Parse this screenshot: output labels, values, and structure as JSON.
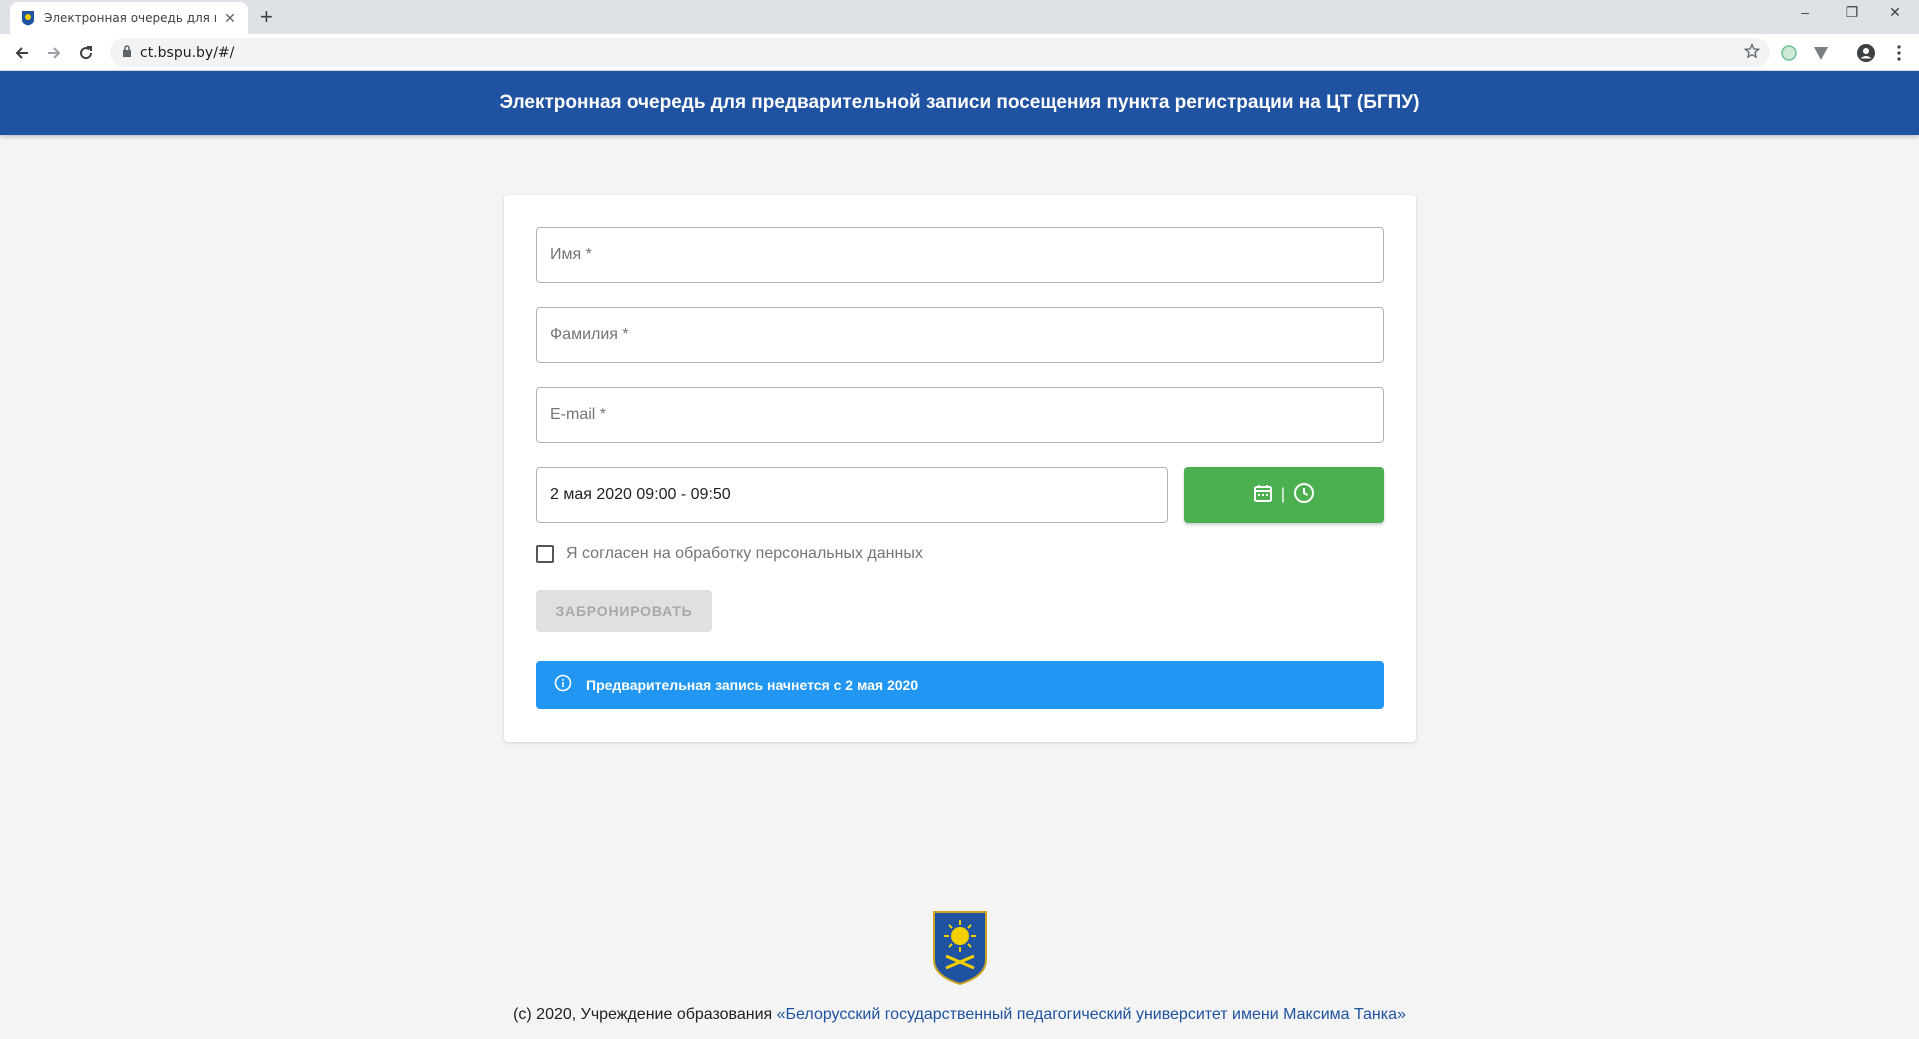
{
  "browser": {
    "tab_title": "Электронная очередь для предварительной записи",
    "tab_close": "✕",
    "new_tab": "+",
    "url": "ct.bspu.by/#/",
    "window_controls": {
      "minimize": "–",
      "restore": "❐",
      "close": "✕"
    }
  },
  "header": {
    "title": "Электронная очередь для предварительной записи посещения пункта регистрации на ЦТ (БГПУ)",
    "background_color": "#1f52a0"
  },
  "form": {
    "first_name_placeholder": "Имя *",
    "last_name_placeholder": "Фамилия *",
    "email_placeholder": "E-mail *",
    "datetime_value": "2 мая 2020 09:00 - 09:50",
    "picker_button": {
      "icons": [
        "calendar-icon",
        "clock-icon"
      ],
      "separator": "|",
      "color": "#4caf50"
    },
    "consent_label": "Я согласен на обработку персональных данных",
    "consent_checked": false,
    "submit_label": "ЗАБРОНИРОВАТЬ",
    "submit_enabled": false
  },
  "info_alert": {
    "text": "Предварительная запись начнется с 2 мая 2020",
    "icon": "info-icon",
    "color": "#2196f3"
  },
  "footer": {
    "copyright": "(с) 2020, Учреждение образования ",
    "university_link": "«Белорусский государственный педагогический университет имени Максима Танка»"
  }
}
